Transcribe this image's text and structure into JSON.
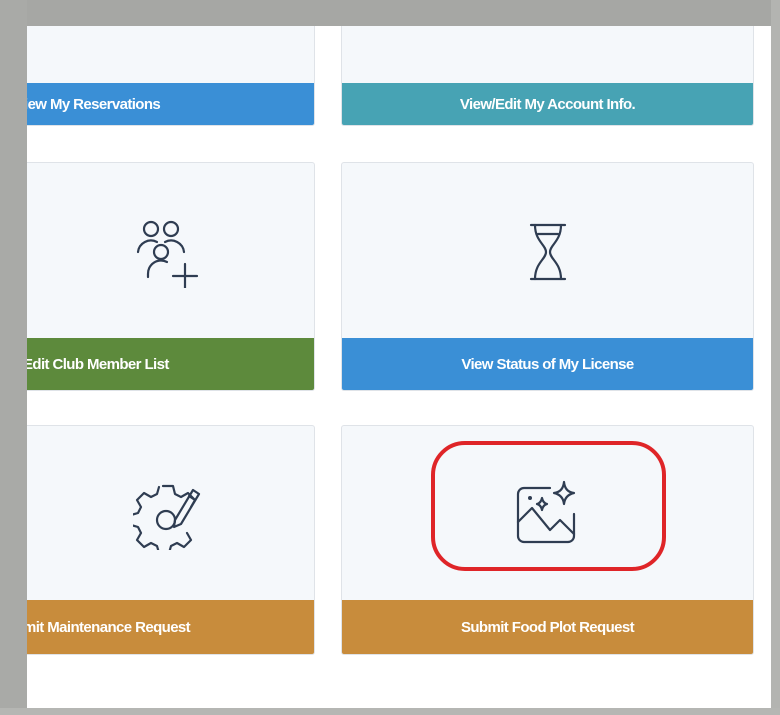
{
  "tiles": {
    "reservations": {
      "label": "iew My Reservations",
      "color": "#3a8fd6"
    },
    "account": {
      "label": "View/Edit My Account Info.",
      "color": "#47a3b4"
    },
    "club": {
      "label": "Edit Club Member List",
      "color": "#5d8a3c",
      "icon": "add-user-icon"
    },
    "license": {
      "label": "View Status of My License",
      "color": "#3a8fd6",
      "icon": "hourglass-icon"
    },
    "maintenance": {
      "label": "mit Maintenance Request",
      "color": "#c88c3c",
      "icon": "gear-pencil-icon"
    },
    "food_plot": {
      "label": "Submit Food Plot Request",
      "color": "#c88c3c",
      "icon": "image-sparkle-icon"
    }
  },
  "highlight": {
    "color": "#df2528",
    "target": "food_plot"
  }
}
